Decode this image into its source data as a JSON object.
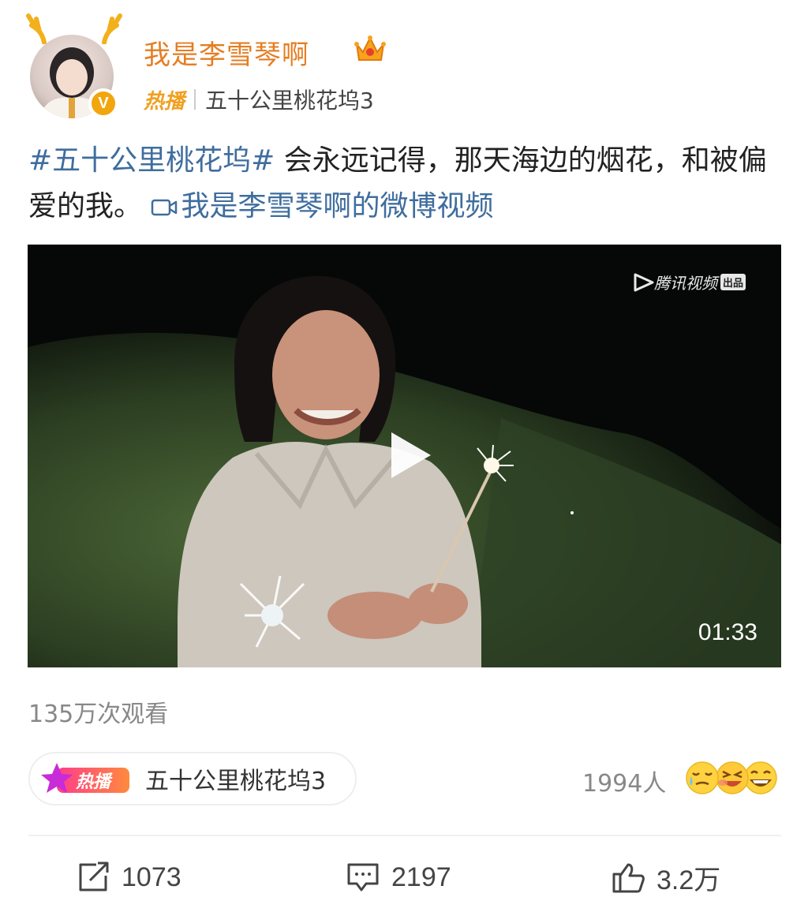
{
  "post": {
    "author": {
      "name": "我是李雪琴啊",
      "verified_badge": "V",
      "crown_icon": "crown-icon"
    },
    "source": {
      "hot_label": "热播",
      "title": "五十公里桃花坞3"
    },
    "text": {
      "topic": "#五十公里桃花坞#",
      "body": " 会永远记得，那天海边的烟花，和被偏爱的我。",
      "video_link": "我是李雪琴啊的微博视频"
    },
    "video": {
      "watermark": "腾讯视频",
      "watermark_badge": "出品",
      "duration": "01:33"
    },
    "views": "135万次观看",
    "hot_chip": {
      "label": "热播",
      "title": "五十公里桃花坞3"
    },
    "reactions": {
      "count": "1994人",
      "emojis": [
        "crying-face-icon",
        "laughing-face-icon",
        "grinning-face-icon"
      ]
    },
    "actions": {
      "repost": "1073",
      "comment": "2197",
      "like": "3.2万"
    }
  },
  "colors": {
    "username": "#e67d22",
    "link": "#3f6d9e",
    "hot": "#f0a020",
    "muted": "#888888"
  }
}
